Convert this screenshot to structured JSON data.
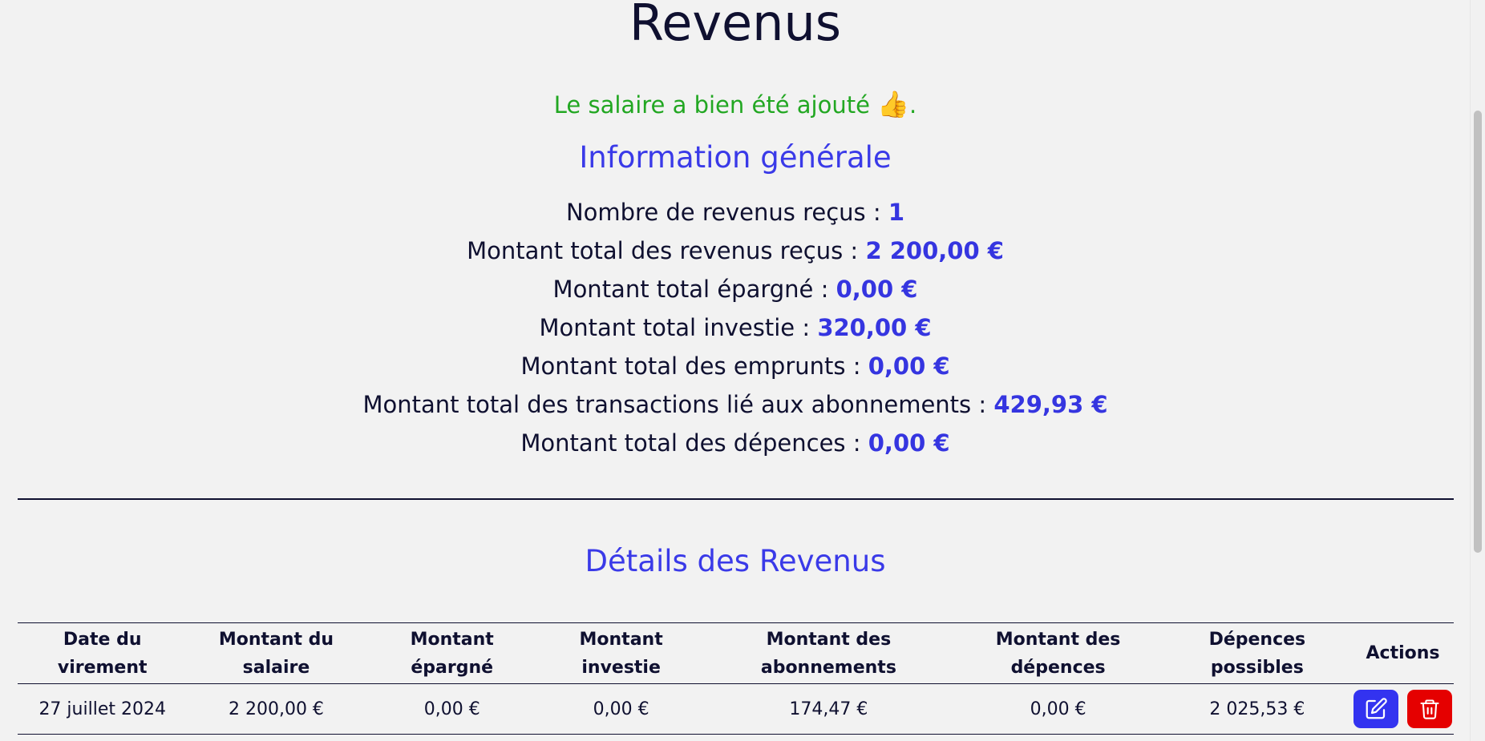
{
  "page": {
    "title": "Revenus"
  },
  "flash": {
    "message": "Le salaire a bien été ajouté",
    "emoji": "👍",
    "suffix": "."
  },
  "general": {
    "heading": "Information générale",
    "stats": [
      {
        "label": "Nombre de revenus reçus :",
        "value": "1"
      },
      {
        "label": "Montant total des revenus reçus :",
        "value": "2 200,00 €"
      },
      {
        "label": "Montant total épargné :",
        "value": "0,00 €"
      },
      {
        "label": "Montant total investie :",
        "value": "320,00 €"
      },
      {
        "label": "Montant total des emprunts :",
        "value": "0,00 €"
      },
      {
        "label": "Montant total des transactions lié aux abonnements :",
        "value": "429,93 €"
      },
      {
        "label": "Montant total des dépences :",
        "value": "0,00 €"
      }
    ]
  },
  "details": {
    "heading": "Détails des Revenus",
    "columns": [
      [
        "Date du",
        "virement"
      ],
      [
        "Montant du",
        "salaire"
      ],
      [
        "Montant",
        "épargné"
      ],
      [
        "Montant",
        "investie"
      ],
      [
        "Montant des",
        "abonnements"
      ],
      [
        "Montant des",
        "dépences"
      ],
      [
        "Dépences",
        "possibles"
      ],
      [
        "Actions"
      ]
    ],
    "rows": [
      [
        "27 juillet 2024",
        "2 200,00 €",
        "0,00 €",
        "0,00 €",
        "174,47 €",
        "0,00 €",
        "2 025,53 €"
      ]
    ]
  },
  "icons": {
    "edit": "pencil-square-icon",
    "delete": "trash-icon"
  },
  "colors": {
    "accent": "#3535e0",
    "success": "#22a722",
    "danger": "#e50000",
    "text": "#0f1030"
  }
}
